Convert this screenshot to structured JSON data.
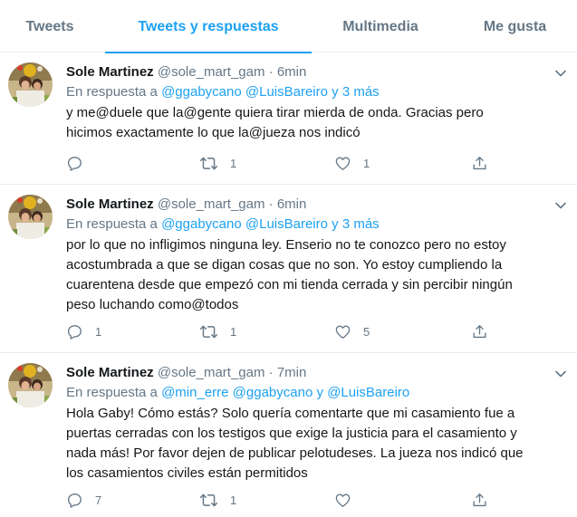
{
  "tabs": [
    {
      "label": "Tweets",
      "active": false
    },
    {
      "label": "Tweets y respuestas",
      "active": true
    },
    {
      "label": "Multimedia",
      "active": false
    },
    {
      "label": "Me gusta",
      "active": false
    }
  ],
  "colors": {
    "accent": "#1da1f2",
    "text": "#14171a",
    "secondary": "#657786",
    "divider": "#e6ecf0"
  },
  "tweets": [
    {
      "name": "Sole Martinez",
      "handle": "@sole_mart_gam",
      "dot": "·",
      "time": "6min",
      "reply_prefix": "En respuesta a",
      "mentions": [
        "@ggabycano",
        "@LuisBareiro"
      ],
      "reply_rest": "y 3 más",
      "text_lines": [
        "y me@duele que la@gente quiera tirar mierda de onda. Gracias pero",
        "hicimos exactamente lo que la@jueza nos indicó"
      ],
      "replies": "",
      "retweets": "1",
      "likes": "1"
    },
    {
      "name": "Sole Martinez",
      "handle": "@sole_mart_gam",
      "dot": "·",
      "time": "6min",
      "reply_prefix": "En respuesta a",
      "mentions": [
        "@ggabycano",
        "@LuisBareiro"
      ],
      "reply_rest": "y 3 más",
      "text_lines": [
        "por lo que no infligimos ninguna ley. Enserio no te conozco pero no estoy",
        "acostumbrada a que se digan cosas que no son. Yo estoy cumpliendo la",
        "cuarentena desde que empezó con mi tienda cerrada y sin percibir ningún",
        "peso luchando como@todos"
      ],
      "replies": "1",
      "retweets": "1",
      "likes": "5"
    },
    {
      "name": "Sole Martinez",
      "handle": "@sole_mart_gam",
      "dot": "·",
      "time": "7min",
      "reply_prefix": "En respuesta a",
      "mentions": [
        "@min_erre",
        "@ggabycano"
      ],
      "reply_rest": "y @LuisBareiro",
      "text_lines": [
        "Hola Gaby! Cómo estás? Solo quería comentarte que mi casamiento fue a",
        "puertas cerradas con los testigos que exige la justicia para el casamiento y",
        "nada más! Por favor dejen de publicar pelotudeses. La jueza nos indicó que",
        "los casamientos civiles están permitidos"
      ],
      "replies": "7",
      "retweets": "1",
      "likes": ""
    }
  ]
}
